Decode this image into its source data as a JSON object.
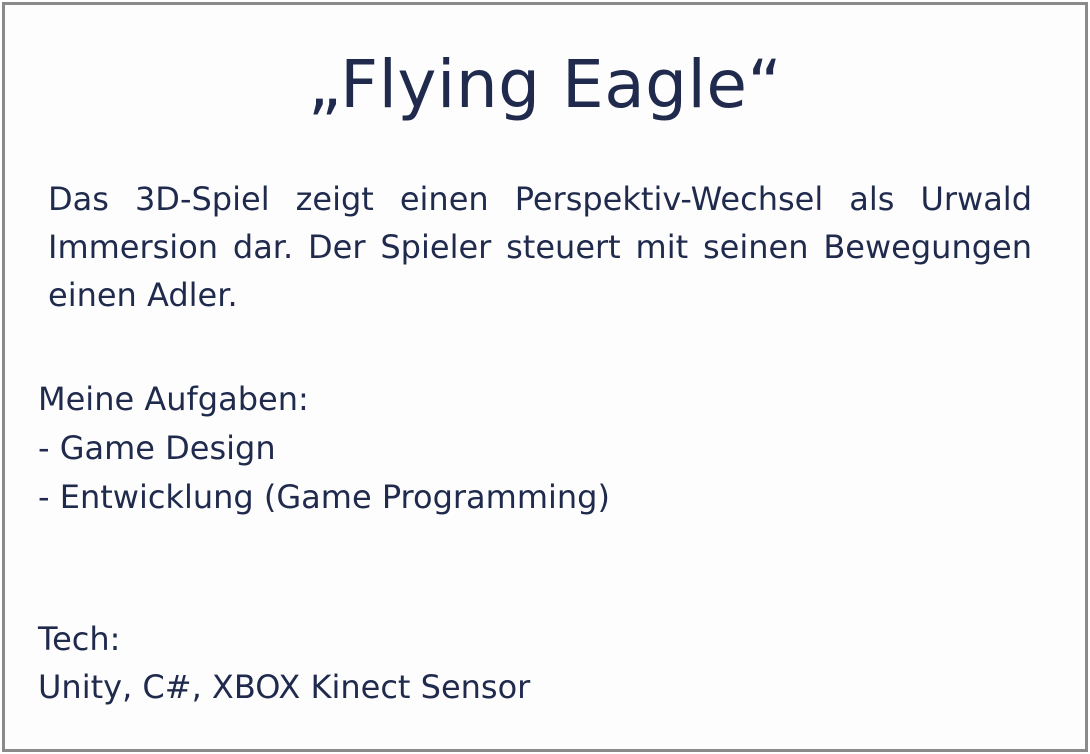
{
  "card": {
    "title": "„Flying Eagle“",
    "description": "Das 3D-Spiel zeigt einen Perspektiv-Wechsel als Urwald Immersion dar. Der Spieler steuert mit seinen Bewegungen einen Adler.",
    "tasks": {
      "heading": "Meine Aufgaben:",
      "items": [
        "- Game Design",
        "- Entwicklung (Game Programming)"
      ]
    },
    "tech": {
      "heading": "Tech:",
      "value": "Unity, C#, XBOX Kinect Sensor"
    }
  }
}
